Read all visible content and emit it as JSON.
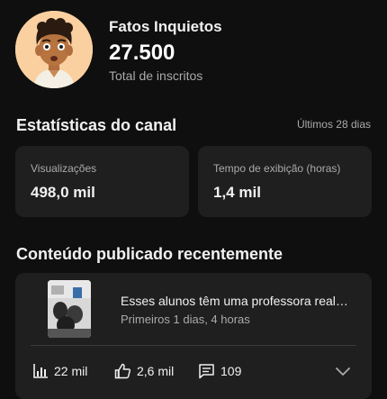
{
  "channel": {
    "name": "Fatos Inquietos",
    "subscribers": "27.500",
    "subscribers_label": "Total de inscritos"
  },
  "stats": {
    "title": "Estatísticas do canal",
    "period": "Últimos 28 dias",
    "cards": [
      {
        "label": "Visualizações",
        "value": "498,0 mil"
      },
      {
        "label": "Tempo de exibição (horas)",
        "value": "1,4 mil"
      }
    ]
  },
  "recent": {
    "title": "Conteúdo publicado recentemente",
    "video": {
      "title": "Esses alunos têm uma professora realm...",
      "meta": "Primeiros 1 dias, 4 horas",
      "views": "22 mil",
      "likes": "2,6 mil",
      "comments": "109"
    }
  },
  "icons": {
    "views": "bar-chart-icon",
    "likes": "thumbs-up-icon",
    "comments": "comment-icon",
    "expand": "chevron-down-icon"
  },
  "colors": {
    "background": "#0f0f0f",
    "card": "#1f1f1f",
    "secondary_text": "#aaaaaa"
  }
}
